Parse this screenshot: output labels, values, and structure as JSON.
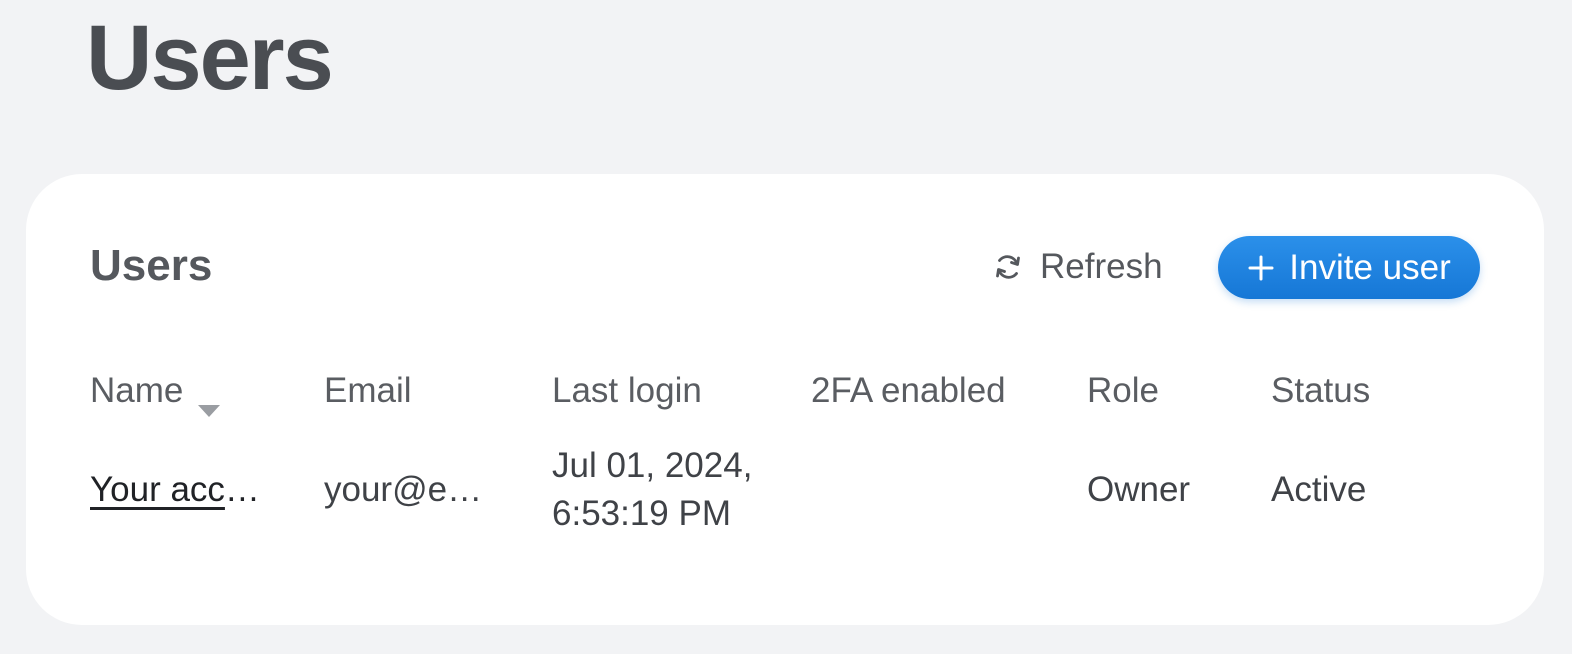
{
  "page": {
    "title": "Users"
  },
  "card": {
    "title": "Users",
    "refresh_label": "Refresh",
    "refresh_icon": "refresh-icon",
    "invite_label": "Invite user",
    "invite_icon": "plus-icon"
  },
  "table": {
    "columns": [
      "Name",
      "Email",
      "Last login",
      "2FA enabled",
      "Role",
      "Status"
    ],
    "sort": {
      "column": "Name",
      "direction": "descending"
    },
    "rows": [
      {
        "name_link": "Your acc",
        "name_rest": "…",
        "email": "your@e…",
        "last_login_line1": "Jul 01, 2024,",
        "last_login_line2": "6:53:19 PM",
        "twofa": "",
        "role": "Owner",
        "status": "Active"
      }
    ]
  },
  "colors": {
    "background": "#f2f3f5",
    "card": "#ffffff",
    "accent": "#1677d6",
    "text": "#4a4d52"
  }
}
